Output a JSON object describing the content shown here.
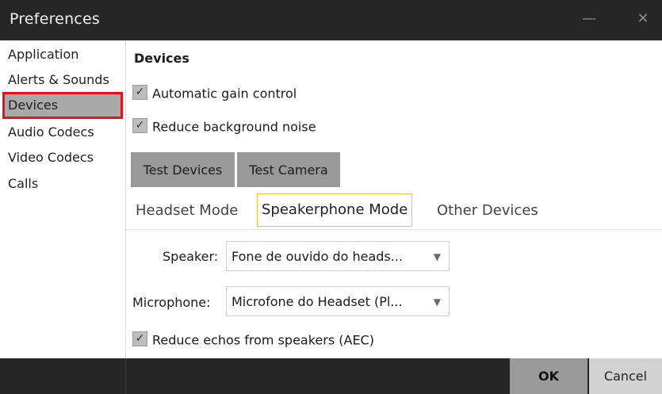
{
  "window": {
    "title": "Preferences",
    "minimize_glyph": "—",
    "close_glyph": "✕"
  },
  "sidebar": {
    "items": [
      {
        "label": "Application"
      },
      {
        "label": "Alerts & Sounds"
      },
      {
        "label": "Devices",
        "selected": true
      },
      {
        "label": "Audio Codecs"
      },
      {
        "label": "Video Codecs"
      },
      {
        "label": "Calls"
      }
    ]
  },
  "devices": {
    "section_title": "Devices",
    "agc_label": "Automatic gain control",
    "agc_checked": true,
    "noise_label": "Reduce background noise",
    "noise_checked": true,
    "test_devices_label": "Test Devices",
    "test_camera_label": "Test Camera"
  },
  "tabs": [
    {
      "label": "Headset Mode"
    },
    {
      "label": "Speakerphone Mode",
      "active": true
    },
    {
      "label": "Other Devices"
    }
  ],
  "speakerphone": {
    "speaker_label": "Speaker:",
    "speaker_value": "Fone de ouvido do heads...",
    "microphone_label": "Microphone:",
    "microphone_value": "Microfone do Headset (Pl...",
    "aec_label": "Reduce echos from speakers (AEC)",
    "aec_checked": true
  },
  "footer": {
    "ok_label": "OK",
    "cancel_label": "Cancel"
  },
  "icons": {
    "check": "✓",
    "dropdown": "▼"
  },
  "colors": {
    "titlebar": "#262626",
    "selection_highlight": "#e8101c",
    "active_tab_border": "#f2c23a",
    "button_gray": "#999999"
  }
}
